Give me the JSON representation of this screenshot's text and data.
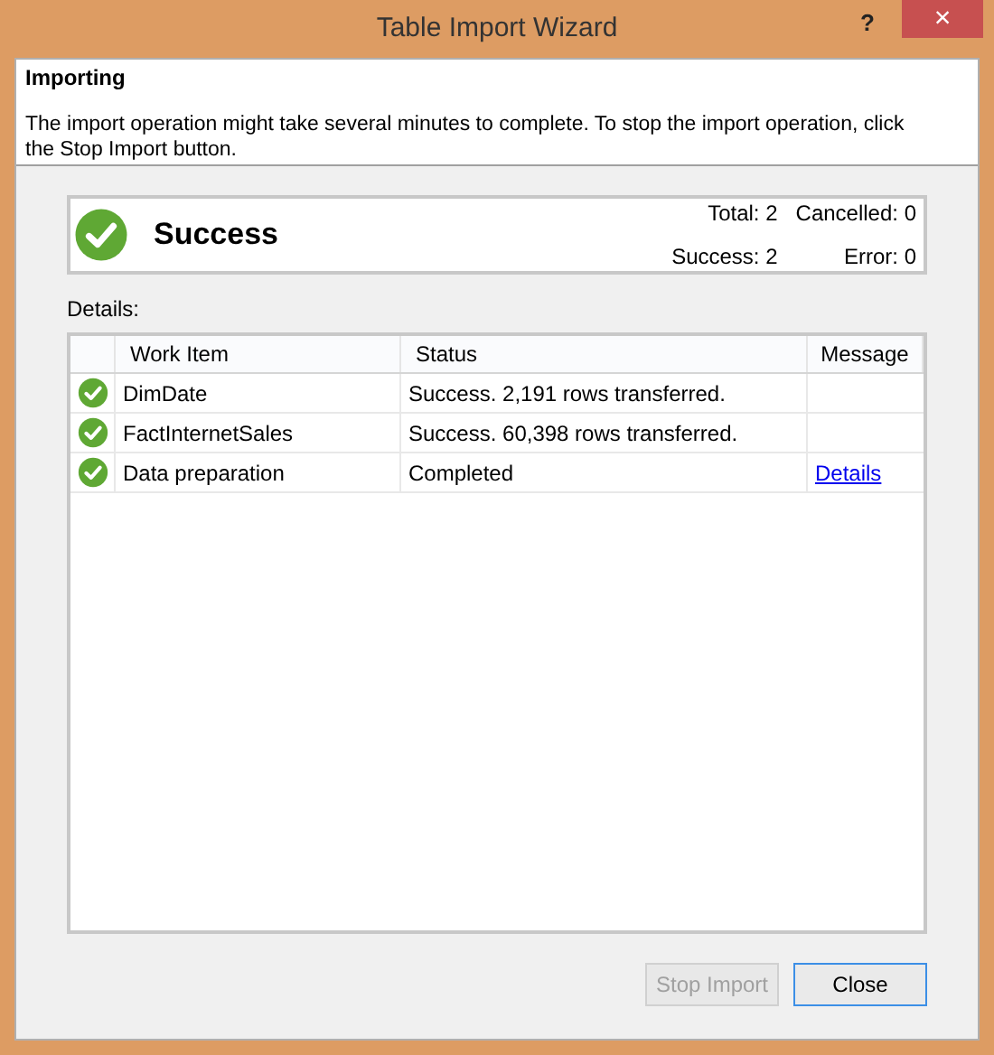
{
  "window": {
    "title": "Table Import Wizard",
    "help": "?",
    "close": "×"
  },
  "header": {
    "title": "Importing",
    "description": "The import operation might take several minutes to complete. To stop the import operation, click the Stop Import button."
  },
  "summary": {
    "kind": "success",
    "title": "Success",
    "counts": [
      {
        "label": "Total: 2"
      },
      {
        "label": "Cancelled: 0"
      },
      {
        "label": "Success: 2"
      },
      {
        "label": "Error: 0"
      }
    ]
  },
  "details_label": "Details:",
  "table": {
    "columns": [
      "Work Item",
      "Status",
      "Message"
    ],
    "rows": [
      {
        "kind": "success",
        "work_item": "DimDate",
        "status": "Success. 2,191 rows transferred."
      },
      {
        "kind": "success",
        "work_item": "FactInternetSales",
        "status": "Success. 60,398 rows transferred."
      },
      {
        "kind": "success",
        "work_item": "Data preparation",
        "status": "Completed",
        "message": "Details"
      }
    ]
  },
  "buttons": [
    {
      "label": "Stop Import",
      "disabled": true,
      "default": false
    },
    {
      "label": "Close",
      "disabled": false,
      "default": true
    }
  ]
}
